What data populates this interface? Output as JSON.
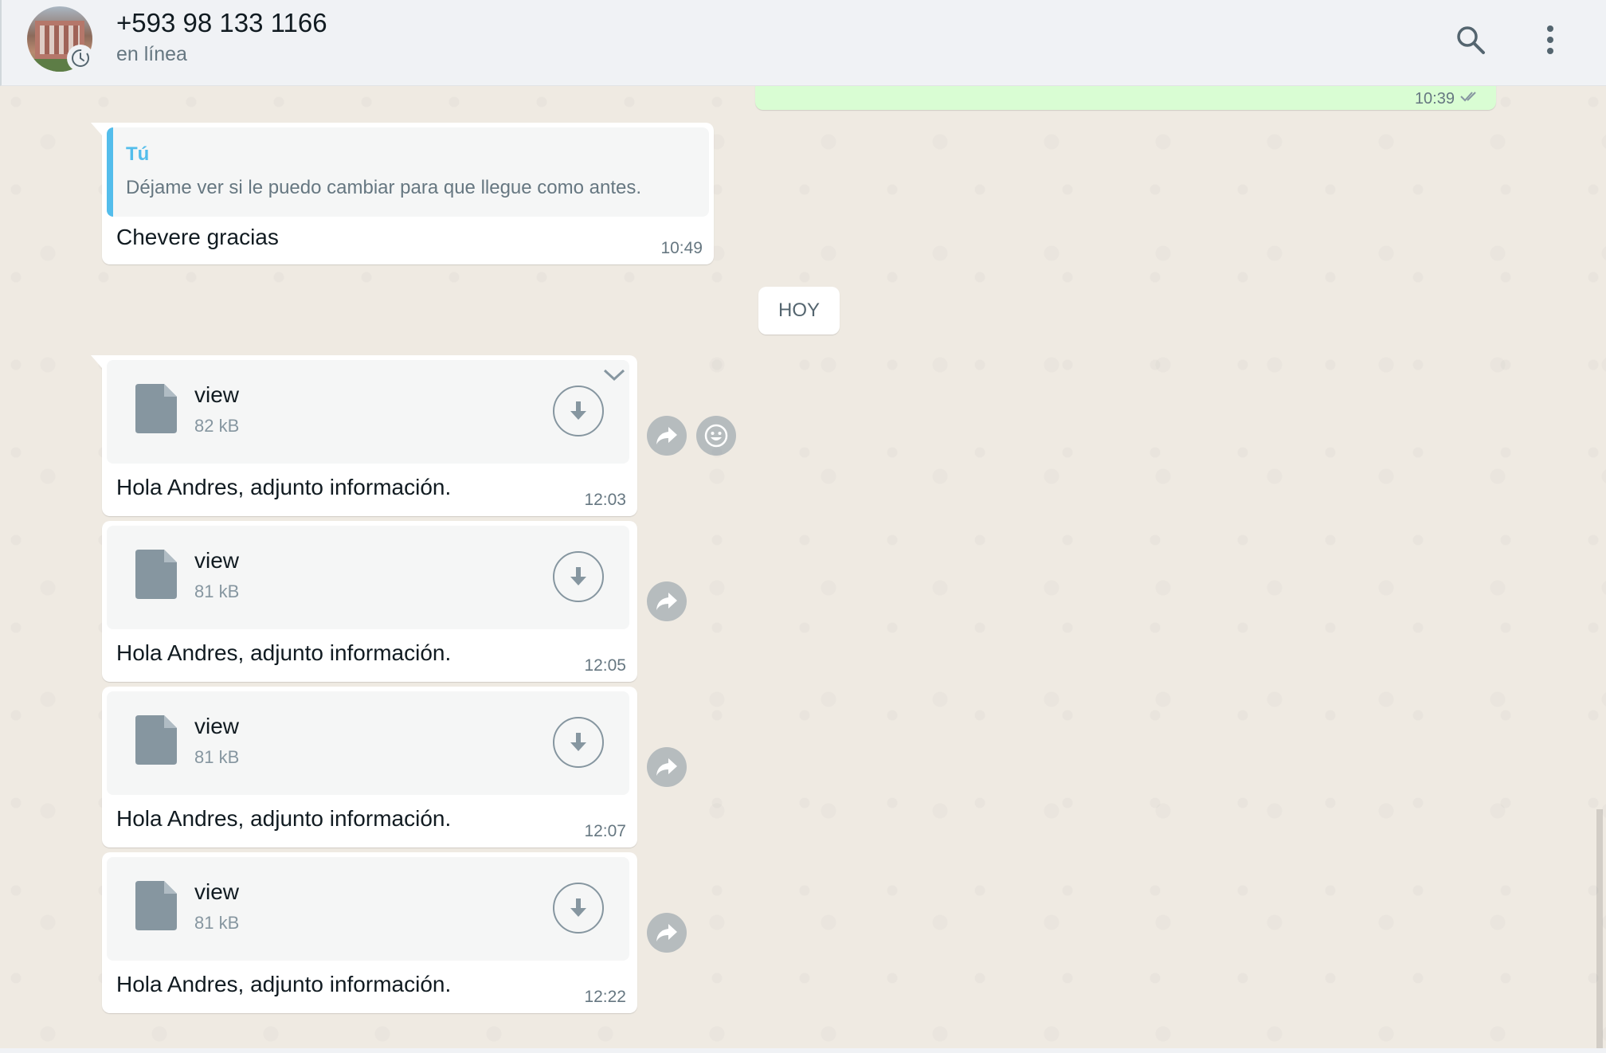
{
  "header": {
    "contact_name": "+593 98 133 1166",
    "status": "en línea",
    "icons": [
      "avatar",
      "status-clock-icon",
      "search-icon",
      "menu-dots-icon"
    ]
  },
  "previous_outgoing": {
    "time": "10:39"
  },
  "reply_message": {
    "quote_author": "Tú",
    "quote_text": "Déjame ver si le puedo cambiar para que llegue como antes.",
    "text": "Chevere gracias",
    "time": "10:49"
  },
  "day_divider": "HOY",
  "file_messages": [
    {
      "file_name": "view",
      "file_size": "82 kB",
      "text": "Hola Andres, adjunto información.",
      "time": "12:03"
    },
    {
      "file_name": "view",
      "file_size": "81 kB",
      "text": "Hola Andres, adjunto información.",
      "time": "12:05"
    },
    {
      "file_name": "view",
      "file_size": "81 kB",
      "text": "Hola Andres, adjunto información.",
      "time": "12:07"
    },
    {
      "file_name": "view",
      "file_size": "81 kB",
      "text": "Hola Andres, adjunto información.",
      "time": "12:22"
    }
  ],
  "colors": {
    "outgoing_bubble": "#d9fdd3",
    "incoming_bubble": "#ffffff",
    "quote_accent": "#53bdeb",
    "chat_bg": "#efeae2"
  }
}
